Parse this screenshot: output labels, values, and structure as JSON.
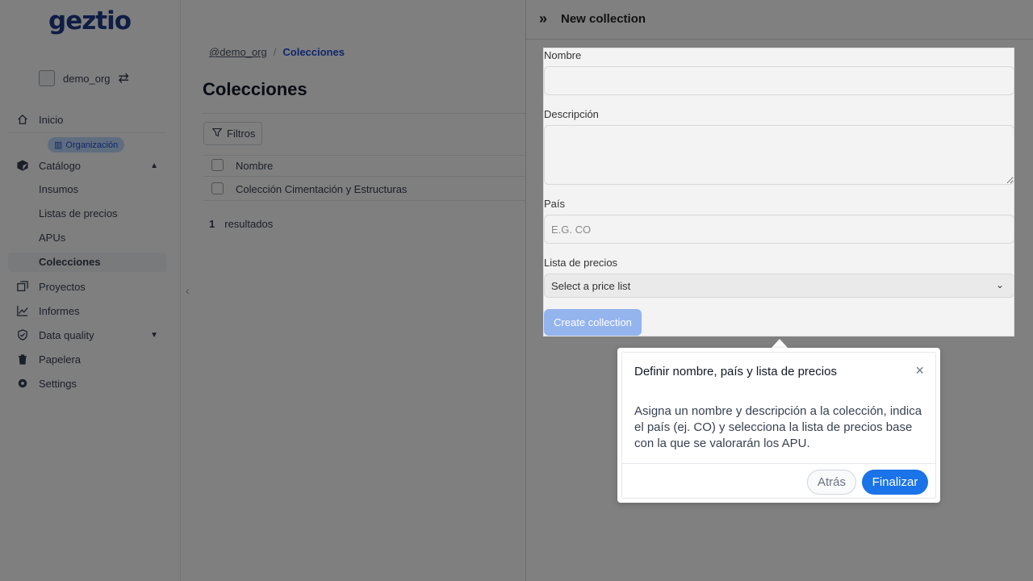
{
  "sidebar": {
    "logo": "geztio",
    "org_name": "demo_org",
    "org_badge": "Organización",
    "nav": {
      "inicio": "Inicio",
      "catalogo": "Catálogo",
      "insumos": "Insumos",
      "listas_precios": "Listas de precios",
      "apus": "APUs",
      "colecciones": "Colecciones",
      "proyectos": "Proyectos",
      "informes": "Informes",
      "data_quality": "Data quality",
      "papelera": "Papelera",
      "settings": "Settings"
    }
  },
  "main": {
    "breadcrumb": {
      "org": "@demo_org",
      "separator": "/",
      "current": "Colecciones"
    },
    "title": "Colecciones",
    "filter_label": "Filtros",
    "table": {
      "header": "Nombre",
      "rows": [
        "Colección Cimentación y Estructuras"
      ]
    },
    "results_count": "1",
    "results_label": "resultados"
  },
  "drawer": {
    "title": "New collection",
    "form": {
      "name_label": "Nombre",
      "name_value": "",
      "description_label": "Descripción",
      "description_value": "",
      "country_label": "País",
      "country_placeholder": "E.G. CO",
      "price_list_label": "Lista de precios",
      "price_list_selected": "Select a price list",
      "submit_label": "Create collection"
    }
  },
  "tour": {
    "title": "Definir nombre, país y lista de precios",
    "body": "Asigna un nombre y descripción a la colección, indica el país (ej. CO) y selecciona la lista de precios base con la que se valorarán los APU.",
    "back_label": "Atrás",
    "finish_label": "Finalizar"
  },
  "colors": {
    "brand": "#1e3a8a",
    "accent": "#1d4ed8",
    "primary_button": "#1a73e8",
    "disabled_button": "#94b4ee",
    "badge_bg": "#bfdbfe"
  }
}
